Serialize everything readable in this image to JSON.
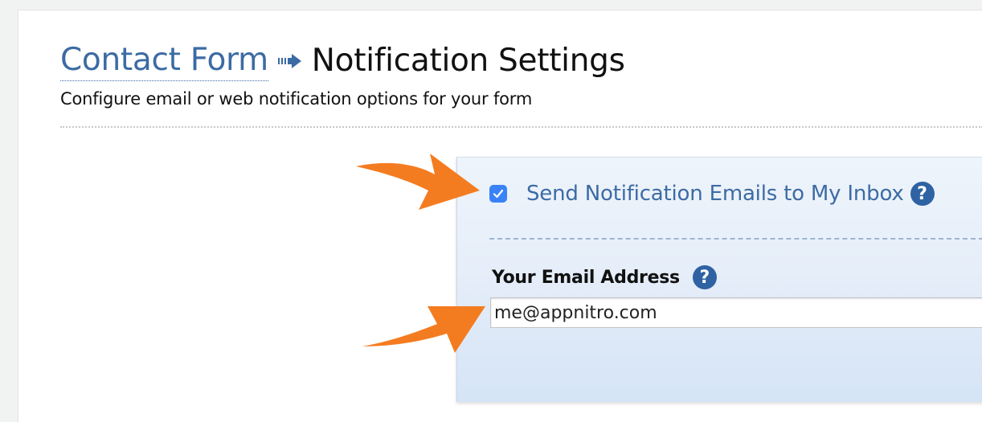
{
  "breadcrumb": {
    "parent_label": "Contact Form",
    "current_title": "Notification Settings"
  },
  "subtitle": "Configure email or web notification options for your form",
  "notifications": {
    "send_email_label": "Send Notification Emails to My Inbox",
    "send_email_checked": true,
    "help_glyph": "?",
    "email_label": "Your Email Address",
    "email_value": "me@appnitro.com"
  },
  "icons": {
    "breadcrumb_separator": "arrow-right-icon",
    "help": "question-circle-icon",
    "checkbox": "checkmark-icon",
    "callout": "orange-pointer-arrow-icon"
  },
  "colors": {
    "link": "#3c6ba4",
    "help_icon": "#2f62a3",
    "checkbox": "#3a82f7",
    "callout_arrow": "#f47c20",
    "panel_top": "#eef4fb",
    "panel_bottom": "#d5e4f6"
  }
}
